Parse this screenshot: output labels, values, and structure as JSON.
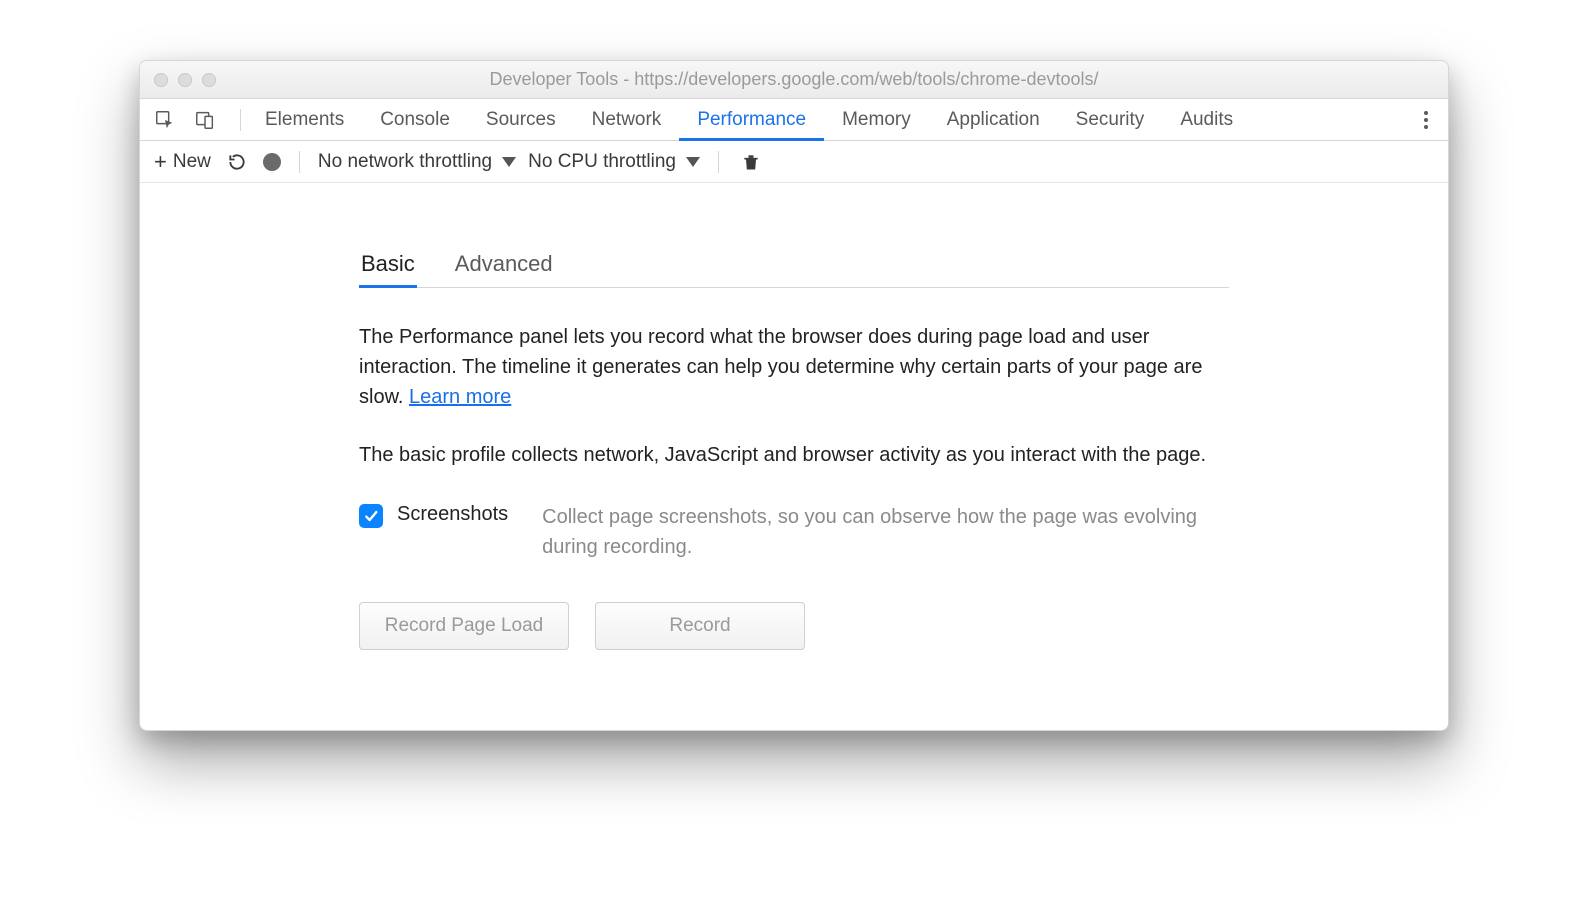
{
  "window": {
    "title": "Developer Tools - https://developers.google.com/web/tools/chrome-devtools/"
  },
  "tabs": {
    "items": [
      "Elements",
      "Console",
      "Sources",
      "Network",
      "Performance",
      "Memory",
      "Application",
      "Security",
      "Audits"
    ],
    "active_index": 4
  },
  "toolbar": {
    "new_label": "New",
    "network_throttling": "No network throttling",
    "cpu_throttling": "No CPU throttling"
  },
  "panel": {
    "subtabs": [
      "Basic",
      "Advanced"
    ],
    "active_subtab_index": 0,
    "description_1": "The Performance panel lets you record what the browser does during page load and user interaction. The timeline it generates can help you determine why certain parts of your page are slow.  ",
    "learn_more": "Learn more",
    "description_2": "The basic profile collects network, JavaScript and browser activity as you interact with the page.",
    "option": {
      "label": "Screenshots",
      "description": "Collect page screenshots, so you can observe how the page was evolving during recording.",
      "checked": true
    },
    "buttons": {
      "record_page_load": "Record Page Load",
      "record": "Record"
    }
  }
}
